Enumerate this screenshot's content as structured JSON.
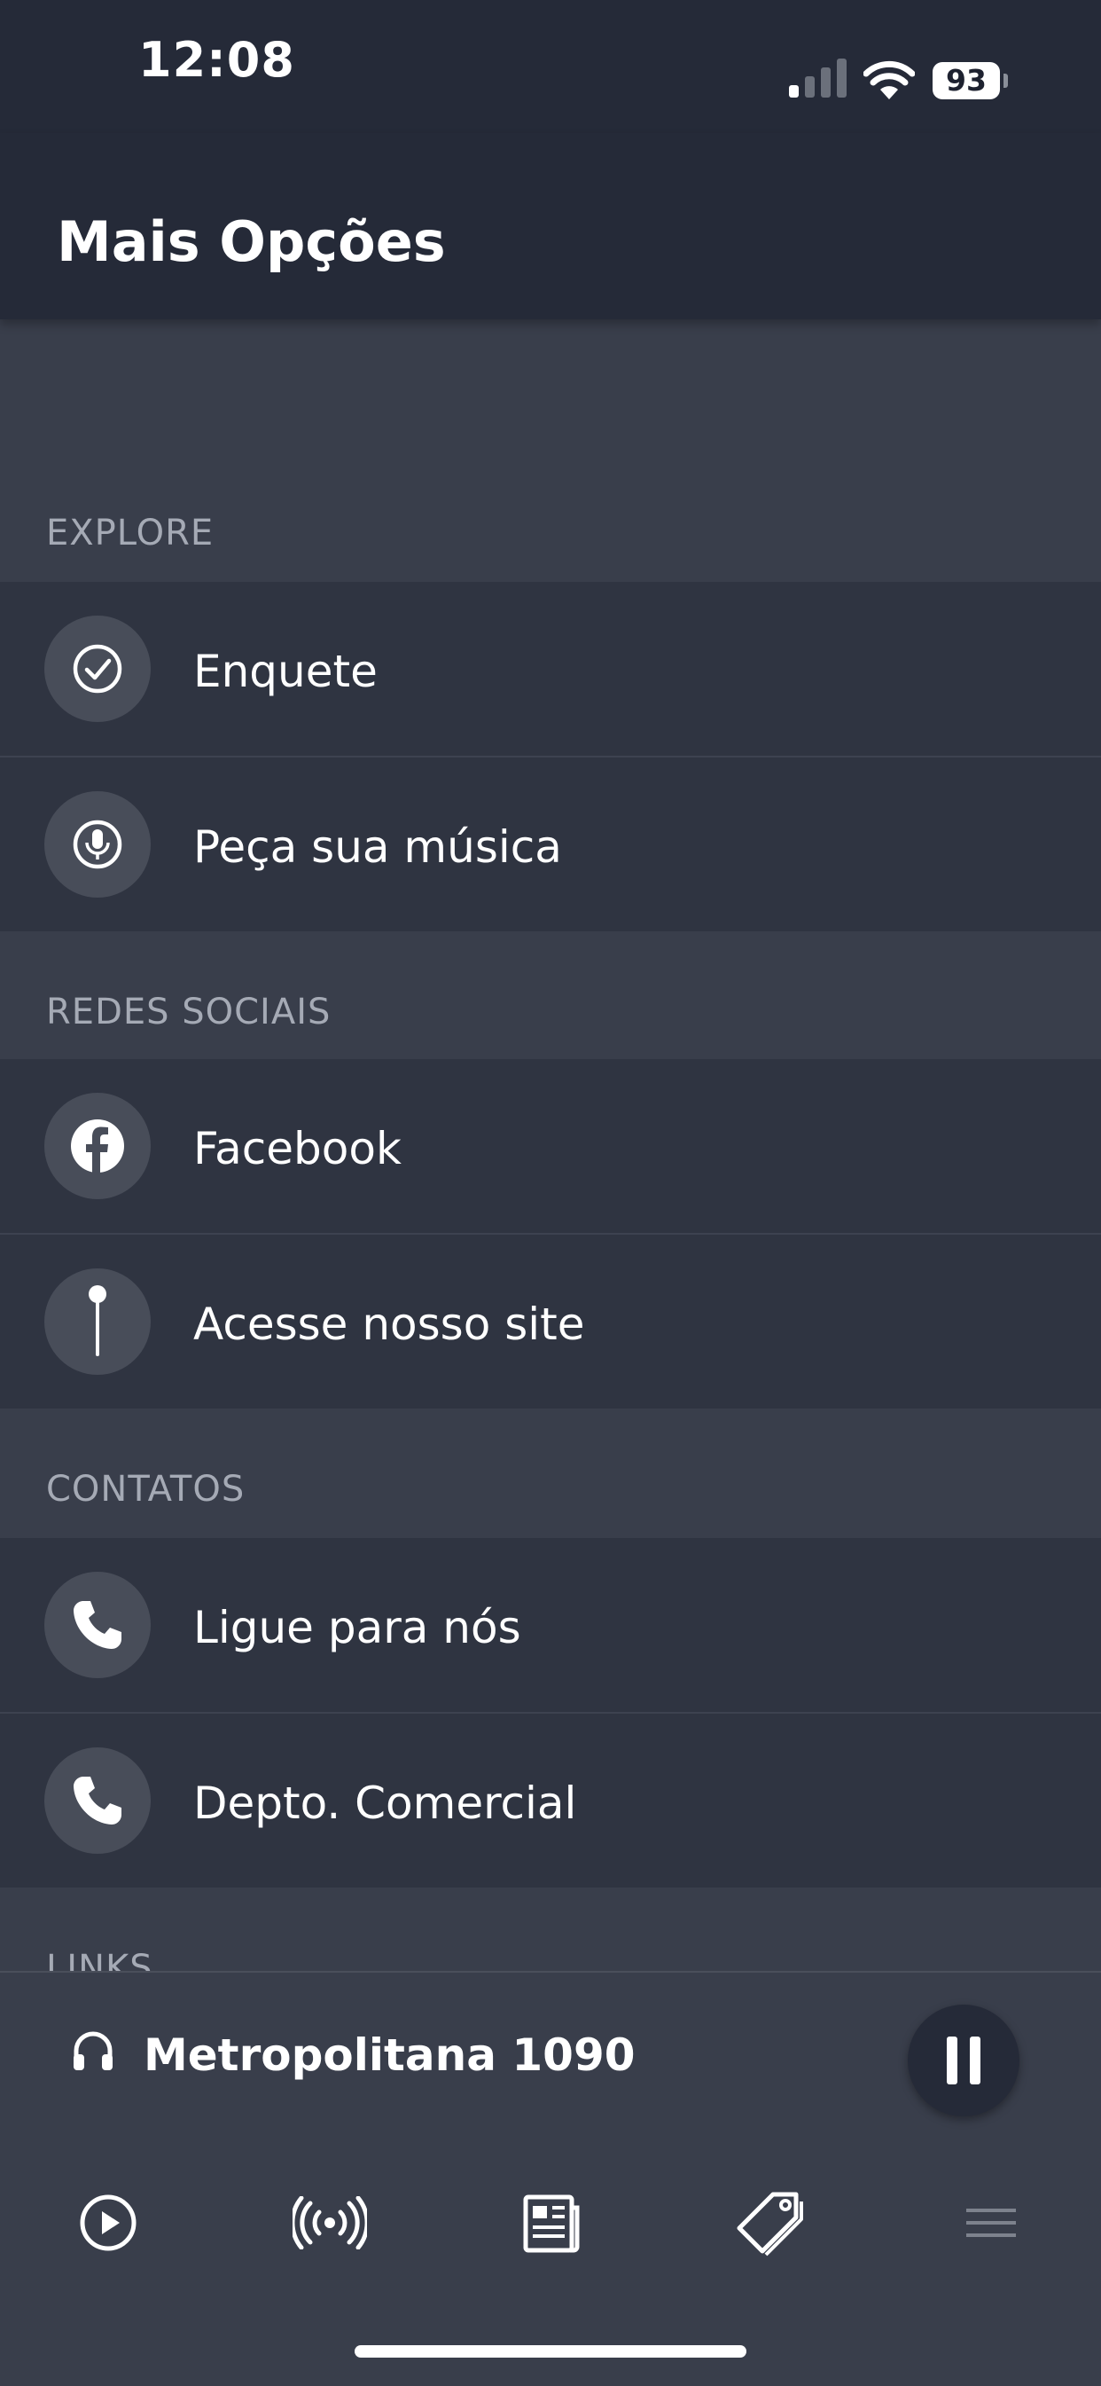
{
  "status_bar": {
    "time": "12:08",
    "battery": "93"
  },
  "header": {
    "title": "Mais Opções"
  },
  "sections": [
    {
      "label": "EXPLORE",
      "items": [
        {
          "label": "Enquete",
          "icon": "check-circle-icon"
        },
        {
          "label": "Peça sua música",
          "icon": "microphone-icon"
        }
      ]
    },
    {
      "label": "REDES SOCIAIS",
      "items": [
        {
          "label": "Facebook",
          "icon": "facebook-icon"
        },
        {
          "label": "Acesse nosso site",
          "icon": "pin-icon"
        }
      ]
    },
    {
      "label": "CONTATOS",
      "items": [
        {
          "label": "Ligue para nós",
          "icon": "phone-icon"
        },
        {
          "label": "Depto. Comercial",
          "icon": "phone-icon"
        }
      ]
    },
    {
      "label": "LINKS",
      "items": []
    }
  ],
  "player": {
    "station": "Metropolitana 1090",
    "state": "playing"
  },
  "tabbar": [
    {
      "icon": "play-icon"
    },
    {
      "icon": "broadcast-icon"
    },
    {
      "icon": "news-icon"
    },
    {
      "icon": "tag-icon"
    },
    {
      "icon": "menu-icon",
      "active": true
    }
  ],
  "colors": {
    "header_bg": "#252a38",
    "page_bg": "#393e4b",
    "item_bg": "#2f3441",
    "icon_circle": "#484d59",
    "section_text": "#a5aab5"
  }
}
